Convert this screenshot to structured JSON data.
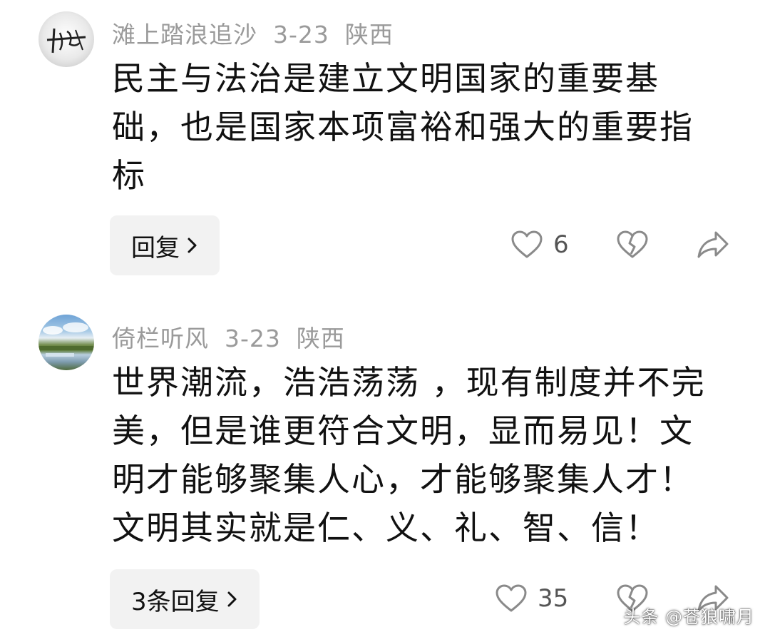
{
  "comments": [
    {
      "username": "滩上踏浪追沙",
      "date": "3-23",
      "location": "陕西",
      "text": "民主与法治是建立文明国家的重要基础，也是国家本项富裕和强大的重要指标",
      "reply_label": "回复",
      "likes": "6",
      "avatar_icon": "calligraphy-avatar"
    },
    {
      "username": "倚栏听风",
      "date": "3-23",
      "location": "陕西",
      "text": "世界潮流，浩浩荡荡 ，现有制度并不完美，但是谁更符合文明，显而易见！文明才能够聚集人心，才能够聚集人才！文明其实就是仁、义、礼、智、信！",
      "reply_label": "3条回复",
      "likes": "35",
      "avatar_icon": "landscape-avatar"
    }
  ],
  "watermark": "头条 @苍狼啸月",
  "colors": {
    "meta": "#9a9a9a",
    "icon": "#8a8a8a",
    "reply_bg": "#f2f2f2"
  }
}
